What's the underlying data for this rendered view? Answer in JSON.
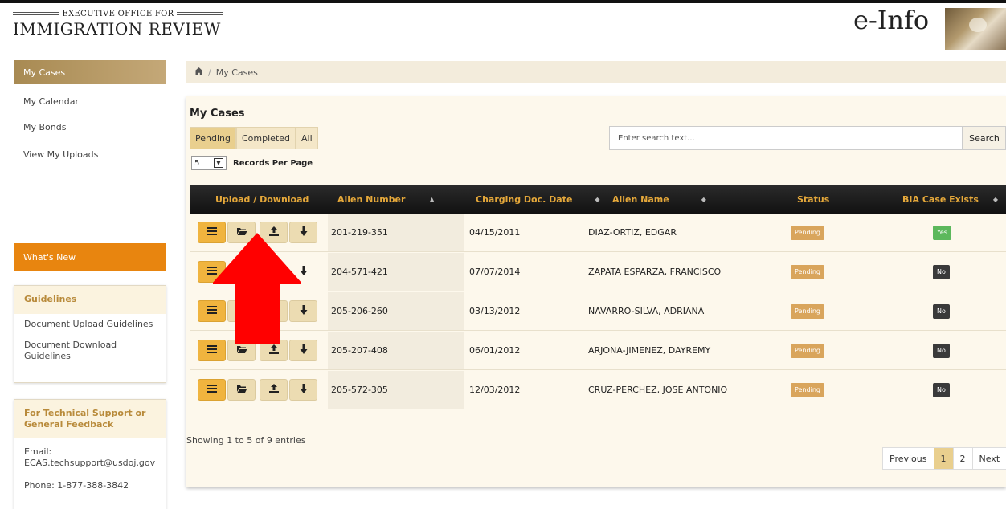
{
  "header": {
    "agency_small": "EXECUTIVE OFFICE FOR",
    "agency_big": "IMMIGRATION REVIEW",
    "app_name": "e-Info"
  },
  "sidebar": {
    "items": [
      {
        "label": "My Cases",
        "active": true
      },
      {
        "label": "My Calendar"
      },
      {
        "label": "My Bonds"
      },
      {
        "label": "View My Uploads"
      }
    ],
    "whats_new": "What's New",
    "guidelines": {
      "title": "Guidelines",
      "links": [
        "Document Upload Guidelines",
        "Document Download Guidelines"
      ]
    },
    "support": {
      "title": "For Technical Support or General Feedback",
      "email_label": "Email:",
      "email": "ECAS.techsupport@usdoj.gov",
      "phone": "Phone:  1-877-388-3842"
    }
  },
  "breadcrumb": {
    "sep": "/",
    "current": "My Cases"
  },
  "main": {
    "title": "My Cases",
    "tabs": [
      {
        "label": "Pending",
        "active": true
      },
      {
        "label": "Completed"
      },
      {
        "label": "All"
      }
    ],
    "records_per_page": {
      "value": "5",
      "label": "Records Per Page"
    },
    "search": {
      "placeholder": "Enter search text...",
      "button": "Search"
    },
    "columns": [
      "Upload / Download",
      "Alien Number",
      "Charging Doc. Date",
      "Alien Name",
      "Status",
      "BIA Case Exists"
    ],
    "rows": [
      {
        "alien_number": "201-219-351",
        "date": "04/15/2011",
        "name": "DIAZ-ORTIZ, EDGAR",
        "status": "Pending",
        "bia": "Yes"
      },
      {
        "alien_number": "204-571-421",
        "date": "07/07/2014",
        "name": "ZAPATA ESPARZA, FRANCISCO",
        "status": "Pending",
        "bia": "No"
      },
      {
        "alien_number": "205-206-260",
        "date": "03/13/2012",
        "name": "NAVARRO-SILVA, ADRIANA",
        "status": "Pending",
        "bia": "No"
      },
      {
        "alien_number": "205-207-408",
        "date": "06/01/2012",
        "name": "ARJONA-JIMENEZ, DAYREMY",
        "status": "Pending",
        "bia": "No"
      },
      {
        "alien_number": "205-572-305",
        "date": "12/03/2012",
        "name": "CRUZ-PERCHEZ, JOSE ANTONIO",
        "status": "Pending",
        "bia": "No"
      }
    ],
    "showing": "Showing 1 to 5 of 9 entries",
    "pager": {
      "previous": "Previous",
      "pages": [
        "1",
        "2"
      ],
      "next": "Next"
    }
  },
  "colors": {
    "accent": "#f0b43e",
    "whats_new": "#e8850f",
    "header_text": "#e5a83a",
    "arrow": "#ff0000"
  }
}
